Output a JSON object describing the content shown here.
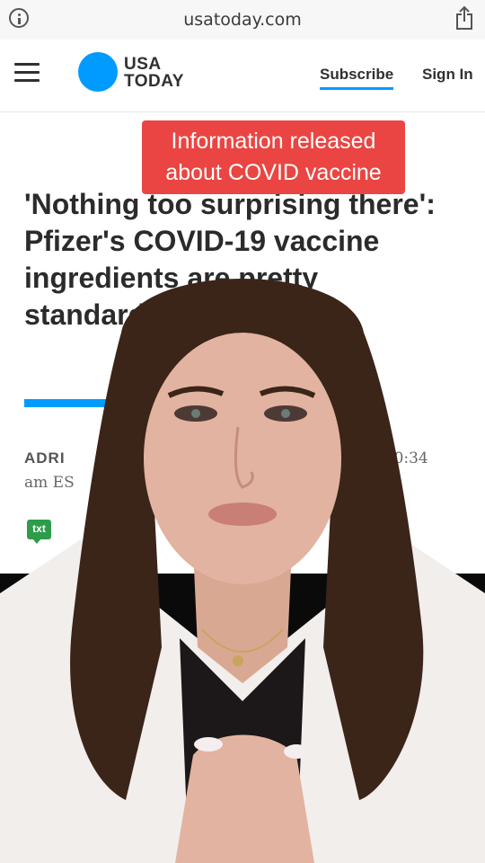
{
  "browser": {
    "url": "usatoday.com",
    "info_icon": "info-icon",
    "share_icon": "share-icon"
  },
  "header": {
    "logo_line1": "USA",
    "logo_line2": "TODAY",
    "subscribe_label": "Subscribe",
    "signin_label": "Sign In",
    "brand_color": "#009bff"
  },
  "article": {
    "headline": "'Nothing too surprising there': Pfizer's COVID-19 vaccine ingredients are pretty standard, experts say",
    "byline_author": "ADRI",
    "byline_time": "Y | 10:34",
    "byline_tail": "am ES",
    "txt_icon_label": "txt"
  },
  "overlay": {
    "caption": "Information released about COVID vaccine",
    "caption_color": "#ea4542"
  }
}
